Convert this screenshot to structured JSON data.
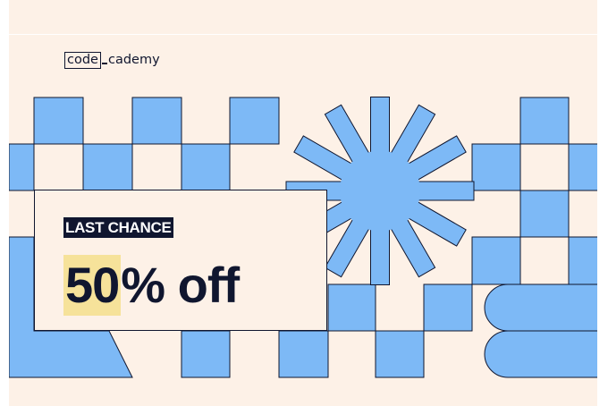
{
  "logo": {
    "part1": "code",
    "part2": "cademy"
  },
  "promo": {
    "badge": "LAST CHANCE",
    "highlight": "50",
    "rest": "% off"
  },
  "colors": {
    "background": "#fdf1e7",
    "pattern_blue": "#7db9f6",
    "outline": "#10162f",
    "highlight": "#f6e29a"
  }
}
